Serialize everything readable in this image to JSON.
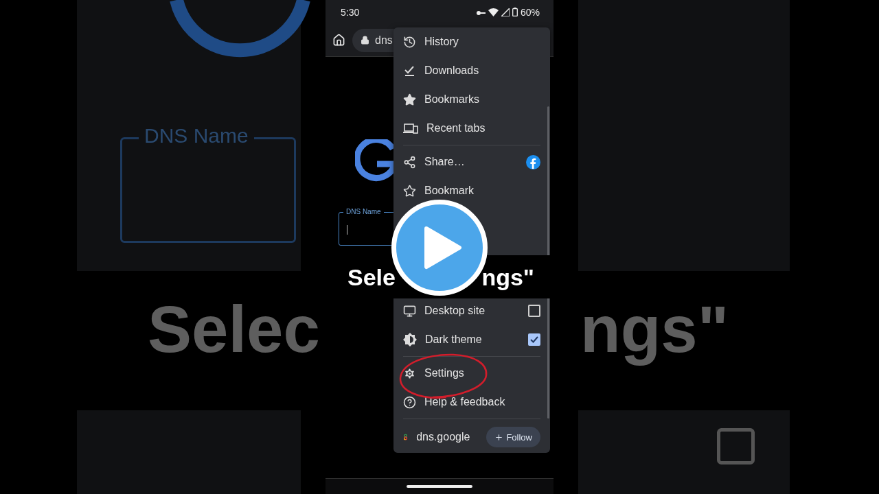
{
  "status_bar": {
    "time": "5:30",
    "battery": "60%"
  },
  "toolbar": {
    "url": "dns"
  },
  "page": {
    "field_label": "DNS Name"
  },
  "menu": {
    "top": [
      {
        "kind": "item",
        "label": "History"
      },
      {
        "kind": "item",
        "label": "Downloads"
      },
      {
        "kind": "item",
        "label": "Bookmarks"
      },
      {
        "kind": "item",
        "label": "Recent tabs"
      },
      {
        "kind": "divider"
      },
      {
        "kind": "share",
        "label": "Share…"
      },
      {
        "kind": "item",
        "label": "Bookmark"
      }
    ],
    "bottom": [
      {
        "kind": "check",
        "label": "Desktop site",
        "checked": false
      },
      {
        "kind": "check",
        "label": "Dark theme",
        "checked": true
      },
      {
        "kind": "divider"
      },
      {
        "kind": "item",
        "label": "Settings"
      },
      {
        "kind": "item",
        "label": "Help & feedback"
      },
      {
        "kind": "divider"
      }
    ],
    "footer": {
      "site": "dns.google",
      "button": "Follow"
    }
  },
  "caption": {
    "left": "Sele",
    "right": "ngs\""
  },
  "backdrop": {
    "field_label": "DNS Name",
    "caption_left": "Selec",
    "caption_right": "ngs\""
  }
}
